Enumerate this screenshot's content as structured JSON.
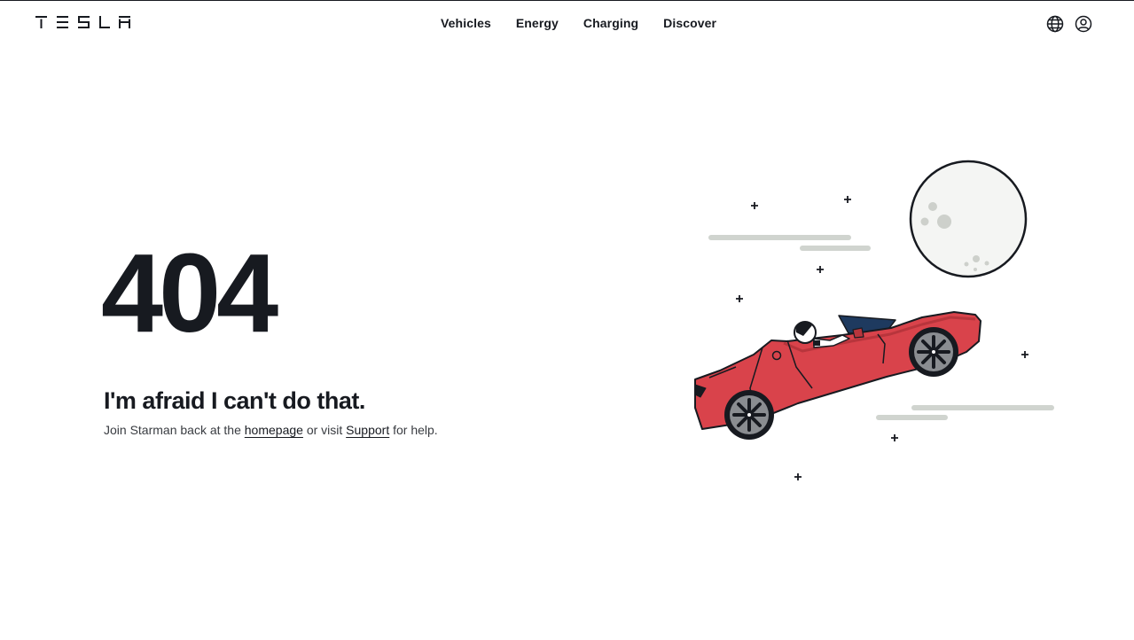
{
  "header": {
    "logo_text": "TESLA",
    "nav": [
      {
        "label": "Vehicles"
      },
      {
        "label": "Energy"
      },
      {
        "label": "Charging"
      },
      {
        "label": "Discover"
      }
    ],
    "icons": [
      "globe-icon",
      "account-icon"
    ]
  },
  "main": {
    "error_code": "404",
    "title": "I'm afraid I can't do that.",
    "message": {
      "prefix": "Join Starman back at the",
      "homepage_link": "homepage",
      "middle": "or visit",
      "support_link": "Support",
      "suffix": "for help."
    }
  },
  "colors": {
    "text": "#171a20",
    "car_red": "#d9434b",
    "moon": "#f4f5f3",
    "moon_shade": "#cdd0cb",
    "speed_lines": "#d0d4cf",
    "windshield": "#1e3a5f"
  }
}
